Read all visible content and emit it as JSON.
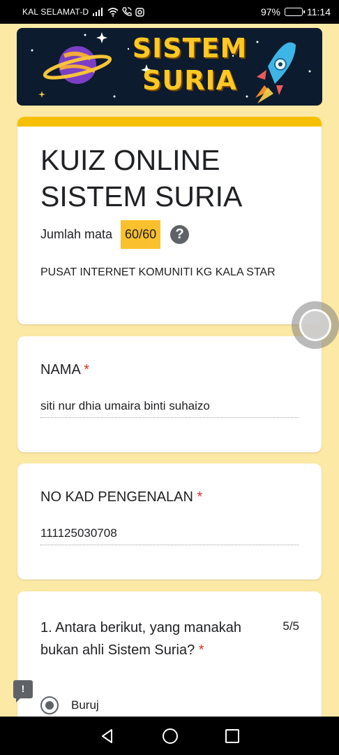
{
  "status_bar": {
    "carrier": "KAL SELAMAT-D",
    "battery": "97%",
    "battery_level": 0.97,
    "time": "11:14"
  },
  "banner": {
    "title_line1": "SISTEM",
    "title_line2": "SURIA"
  },
  "form": {
    "title_line1": "KUIZ ONLINE",
    "title_line2": "SISTEM SURIA",
    "score_label": "Jumlah mata",
    "score_value": "60/60",
    "help_icon": "?",
    "description": "PUSAT INTERNET KOMUNITI KG KALA STAR"
  },
  "fields": {
    "name": {
      "label": "NAMA",
      "required_mark": "*",
      "value": "siti nur dhia umaira binti suhaizo"
    },
    "ic": {
      "label": "NO KAD PENGENALAN",
      "required_mark": "*",
      "value": "111125030708"
    }
  },
  "question1": {
    "text": "1. Antara berikut, yang manakah bukan ahli Sistem Suria?",
    "required_mark": "*",
    "points": "5/5",
    "option_selected": "Buruj"
  },
  "feedback": {
    "icon": "!"
  },
  "colors": {
    "page_bg": "#fde9a6",
    "accent": "#f6bf00",
    "score_badge": "#fbc02d",
    "required": "#d93025",
    "banner_bg": "#0d1b2e",
    "banner_text": "#ffc824"
  },
  "icons": [
    "signal-icon",
    "wifi-icon",
    "wifi-call-icon",
    "instagram-icon",
    "battery-icon",
    "back-icon",
    "home-icon",
    "recents-icon",
    "help-icon",
    "feedback-icon",
    "planet-icon",
    "rocket-icon",
    "star-icon"
  ]
}
